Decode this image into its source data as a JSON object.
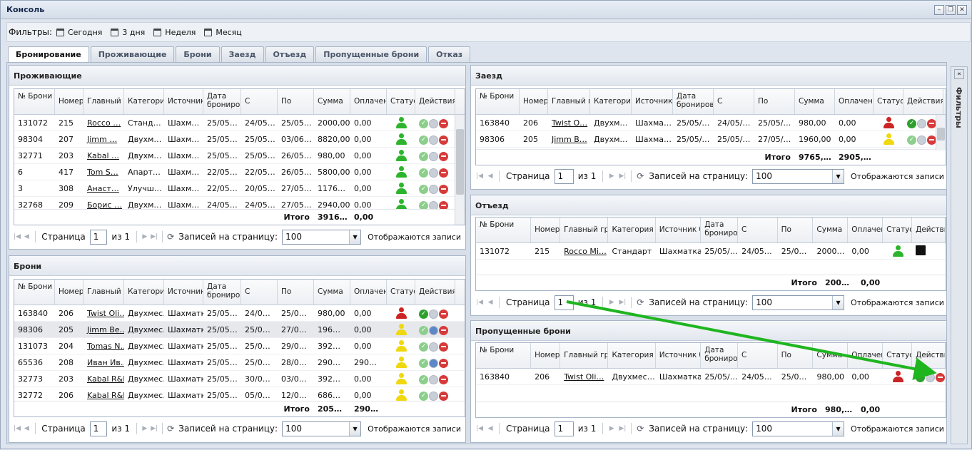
{
  "window": {
    "title": "Консоль"
  },
  "filters": {
    "label": "Фильтры:",
    "items": [
      "Сегодня",
      "3 дня",
      "Неделя",
      "Месяц"
    ]
  },
  "tabs": [
    "Бронирование",
    "Проживающие",
    "Брони",
    "Заезд",
    "Отъезд",
    "Пропущенные брони",
    "Отказ"
  ],
  "side": {
    "label": "Фильтры"
  },
  "pager": {
    "page_label": "Страница",
    "page": "1",
    "of": "из 1",
    "per_page_label": "Записей на страницу:",
    "per_page": "100",
    "showing": "Отображаются записи"
  },
  "residents": {
    "title": "Проживающие",
    "headers": [
      "№ Брони",
      "Номер",
      "Главный гость",
      "Категория",
      "Источник",
      "Дата бронирования",
      "С",
      "По",
      "Сумма",
      "Оплачено",
      "Статус",
      "Действия"
    ],
    "rows": [
      [
        "131072",
        "215",
        "Rocco …",
        "Станд…",
        "Шахм…",
        "25/05…",
        "24/05…",
        "25/05…",
        "2000,00",
        "0,00"
      ],
      [
        "98304",
        "207",
        "Jimm …",
        "Двухм…",
        "Шахм…",
        "25/05…",
        "25/05…",
        "03/06…",
        "8820,00",
        "0,00"
      ],
      [
        "32771",
        "203",
        "Kabal …",
        "Двухм…",
        "Шахм…",
        "25/05…",
        "25/05…",
        "26/05…",
        "980,00",
        "0,00"
      ],
      [
        "6",
        "417",
        "Tom S…",
        "Апарт…",
        "Шахм…",
        "22/05…",
        "22/05…",
        "26/05…",
        "5800,00",
        "0,00"
      ],
      [
        "3",
        "308",
        "Анаст…",
        "Улучш…",
        "Шахм…",
        "22/05…",
        "20/05…",
        "27/05…",
        "1176…",
        "0,00"
      ],
      [
        "32768",
        "209",
        "Борис …",
        "Двухм…",
        "Шахм…",
        "24/05…",
        "24/05…",
        "27/05…",
        "2940,00",
        "0,00"
      ]
    ],
    "total_label": "Итого",
    "total_sum": "3916…",
    "total_paid": "0,00"
  },
  "bookings": {
    "title": "Брони",
    "headers": [
      "№ Брони",
      "Номер",
      "Главный гость",
      "Категория",
      "Источник брони",
      "Дата бронирования",
      "С",
      "По",
      "Сумма",
      "Оплачено",
      "Статус",
      "Действия"
    ],
    "rows": [
      [
        "163840",
        "206",
        "Twist Oli…",
        "Двухмес…",
        "Шахматка",
        "25/05…",
        "24/0…",
        "25/0…",
        "980,00",
        "0,00"
      ],
      [
        "98306",
        "205",
        "Jimm Be…",
        "Двухмес…",
        "Шахматка",
        "25/05…",
        "25/0…",
        "27/0…",
        "196…",
        "0,00"
      ],
      [
        "131073",
        "204",
        "Tomas N…",
        "Двухмес…",
        "Шахматка",
        "25/05…",
        "25/0…",
        "29/0…",
        "392…",
        "0,00"
      ],
      [
        "65536",
        "208",
        "Иван Ив…",
        "Двухмес…",
        "Шахматка",
        "25/05…",
        "25/0…",
        "28/0…",
        "290…",
        "290…"
      ],
      [
        "32773",
        "203",
        "Kabal R&D",
        "Двухмес…",
        "Шахматка",
        "25/05…",
        "30/0…",
        "03/0…",
        "392…",
        "0,00"
      ],
      [
        "32772",
        "206",
        "Kabal R&D",
        "Двухмес…",
        "Шахматка",
        "25/05…",
        "05/0…",
        "12/0…",
        "686…",
        "0,00"
      ]
    ],
    "total_label": "Итого",
    "total_sum": "205…",
    "total_paid": "290…"
  },
  "arrival": {
    "title": "Заезд",
    "headers": [
      "№ Брони",
      "Номер",
      "Главный гость",
      "Категория",
      "Источник брони",
      "Дата бронирования",
      "С",
      "По",
      "Сумма",
      "Оплачено",
      "Статус",
      "Действия"
    ],
    "rows": [
      [
        "163840",
        "206",
        "Twist O…",
        "Двухм…",
        "Шахма…",
        "25/05/…",
        "24/05/…",
        "25/05/…",
        "980,00",
        "0,00"
      ],
      [
        "98306",
        "205",
        "Jimm B…",
        "Двухм…",
        "Шахма…",
        "25/05/…",
        "25/05/…",
        "27/05/…",
        "1960,00",
        "0,00"
      ]
    ],
    "total_label": "Итого",
    "total_sum": "9765,…",
    "total_paid": "2905,…"
  },
  "departure": {
    "title": "Отъезд",
    "headers": [
      "№ Брони",
      "Номер",
      "Главный группа",
      "Категория",
      "Источник брони",
      "Дата бронирования",
      "С",
      "По",
      "Сумма",
      "Оплачено",
      "Статус",
      "Действия"
    ],
    "rows": [
      [
        "131072",
        "215",
        "Rocco Mi…",
        "Стандарт",
        "Шахматка",
        "25/05/…",
        "24/05…",
        "25/0…",
        "2000…",
        "0,00"
      ]
    ],
    "total_label": "Итого",
    "total_sum": "200…",
    "total_paid": "0,00"
  },
  "missed": {
    "title": "Пропущенные брони",
    "headers": [
      "№ Брони",
      "Номер",
      "Главный группа",
      "Категория",
      "Источник брони",
      "Дата бронирования",
      "С",
      "По",
      "Сумма",
      "Оплачено",
      "Статус",
      "Действия"
    ],
    "rows": [
      [
        "163840",
        "206",
        "Twist Oli…",
        "Двухмес…",
        "Шахматка",
        "25/05/…",
        "24/05…",
        "25/0…",
        "980,00",
        "0,00"
      ]
    ],
    "total_label": "Итого",
    "total_sum": "980,…",
    "total_paid": "0,00"
  },
  "colors": {
    "accent_arrow": "#1fb51f",
    "status_green": "#2cb52c",
    "status_red": "#cc2424",
    "status_yellow": "#f0d810"
  }
}
